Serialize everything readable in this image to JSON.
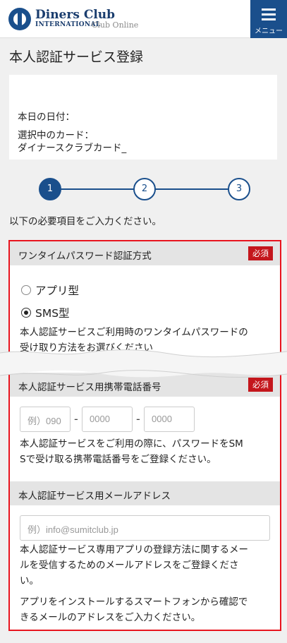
{
  "header": {
    "brand_line1": "Diners Club",
    "brand_line2": "INTERNATIONAL",
    "brand_line3": "Club Online",
    "menu_label": "メニュー"
  },
  "page": {
    "title": "本人認証サービス登録"
  },
  "info": {
    "date_label": "本日の日付：",
    "card_label": "選択中のカード：",
    "card_name": "ダイナースクラブカード_"
  },
  "steps": [
    "1",
    "2",
    "3"
  ],
  "instruction": "以下の必要項目をご入力ください。",
  "otp_section": {
    "title": "ワンタイムパスワード認証方式",
    "required": "必須",
    "options": [
      "アプリ型",
      "SMS型"
    ],
    "selected": "SMS型",
    "desc_line1": "本人認証サービスご利用時のワンタイムパスワードの",
    "desc_line2": "受け取り方法をお選びください"
  },
  "phone_section": {
    "title": "本人認証サービス用携帯電話番号",
    "required": "必須",
    "placeholders": [
      "例）090",
      "0000",
      "0000"
    ],
    "separator": "-",
    "desc_line1": "本人認証サービスをご利用の際に、パスワードをSM",
    "desc_line2": "Sで受け取る携帯電話番号をご登録ください。"
  },
  "email_section": {
    "title": "本人認証サービス用メールアドレス",
    "placeholder": "例）info@sumitclub.jp",
    "desc_line1": "本人認証サービス専用アプリの登録方法に関するメー",
    "desc_line2": "ルを受信するためのメールアドレスをご登録くださ",
    "desc_line3": "い。",
    "desc_line4": "アプリをインストールするスマートフォンから確認で",
    "desc_line5": "きるメールのアドレスをご入力ください。"
  }
}
